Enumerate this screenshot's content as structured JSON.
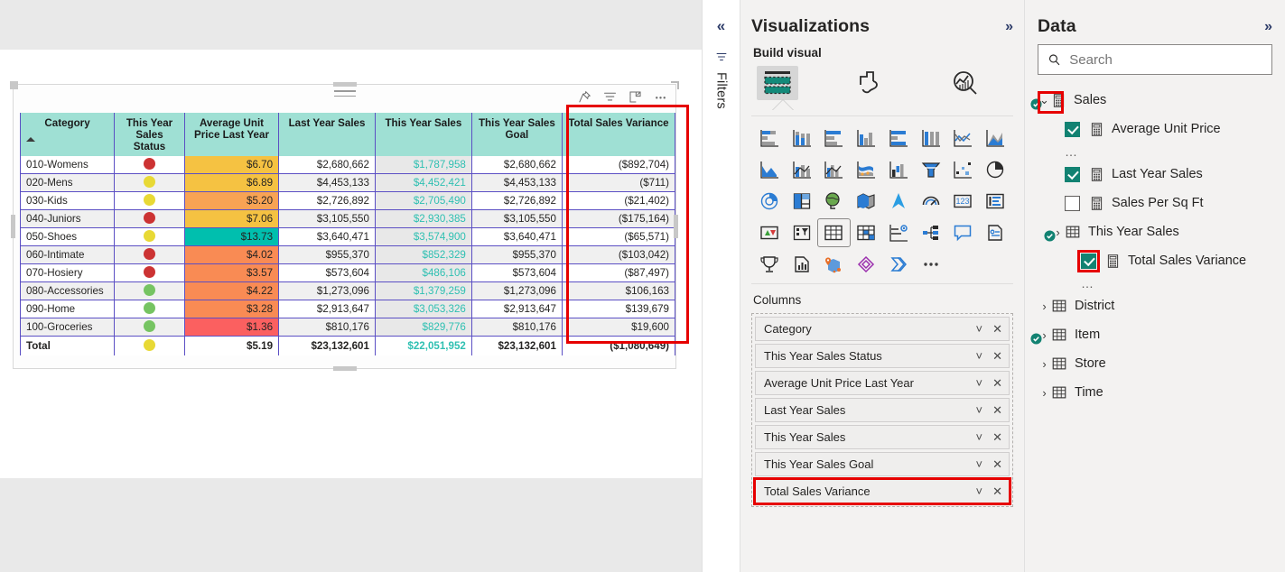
{
  "canvas": {
    "visual": {
      "toolbar_icons": [
        "pin-icon",
        "filter-icon",
        "focus-mode-icon",
        "more-options-icon"
      ],
      "sort_indicator": "ascending-sort-arrow"
    }
  },
  "table": {
    "headers": [
      "Category",
      "This Year Sales Status",
      "Average Unit Price Last Year",
      "Last Year Sales",
      "This Year Sales",
      "This Year Sales Goal",
      "Total Sales Variance"
    ],
    "rows": [
      {
        "category": "010-Womens",
        "status_color": "#cc3333",
        "aup": "$6.70",
        "aup_bg": "#f5c242",
        "lys": "$2,680,662",
        "tys": "$1,787,958",
        "goal": "$2,680,662",
        "variance": "($892,704)"
      },
      {
        "category": "020-Mens",
        "status_color": "#e8d935",
        "aup": "$6.89",
        "aup_bg": "#f5c242",
        "lys": "$4,453,133",
        "tys": "$4,452,421",
        "goal": "$4,453,133",
        "variance": "($711)"
      },
      {
        "category": "030-Kids",
        "status_color": "#e8d935",
        "aup": "$5.20",
        "aup_bg": "#f8a354",
        "lys": "$2,726,892",
        "tys": "$2,705,490",
        "goal": "$2,726,892",
        "variance": "($21,402)"
      },
      {
        "category": "040-Juniors",
        "status_color": "#cc3333",
        "aup": "$7.06",
        "aup_bg": "#f5c242",
        "lys": "$3,105,550",
        "tys": "$2,930,385",
        "goal": "$3,105,550",
        "variance": "($175,164)"
      },
      {
        "category": "050-Shoes",
        "status_color": "#e8d935",
        "aup": "$13.73",
        "aup_bg": "#00bfae",
        "lys": "$3,640,471",
        "tys": "$3,574,900",
        "goal": "$3,640,471",
        "variance": "($65,571)"
      },
      {
        "category": "060-Intimate",
        "status_color": "#cc3333",
        "aup": "$4.02",
        "aup_bg": "#f98b54",
        "lys": "$955,370",
        "tys": "$852,329",
        "goal": "$955,370",
        "variance": "($103,042)"
      },
      {
        "category": "070-Hosiery",
        "status_color": "#cc3333",
        "aup": "$3.57",
        "aup_bg": "#f98b54",
        "lys": "$573,604",
        "tys": "$486,106",
        "goal": "$573,604",
        "variance": "($87,497)"
      },
      {
        "category": "080-Accessories",
        "status_color": "#76c462",
        "aup": "$4.22",
        "aup_bg": "#f98b54",
        "lys": "$1,273,096",
        "tys": "$1,379,259",
        "goal": "$1,273,096",
        "variance": "$106,163"
      },
      {
        "category": "090-Home",
        "status_color": "#76c462",
        "aup": "$3.28",
        "aup_bg": "#f98b54",
        "lys": "$2,913,647",
        "tys": "$3,053,326",
        "goal": "$2,913,647",
        "variance": "$139,679"
      },
      {
        "category": "100-Groceries",
        "status_color": "#76c462",
        "aup": "$1.36",
        "aup_bg": "#fb6060",
        "lys": "$810,176",
        "tys": "$829,776",
        "goal": "$810,176",
        "variance": "$19,600"
      }
    ],
    "total": {
      "category": "Total",
      "status_color": "#e8d935",
      "aup": "$5.19",
      "lys": "$23,132,601",
      "tys": "$22,051,952",
      "goal": "$23,132,601",
      "variance": "($1,080,649)"
    }
  },
  "filters_rail": {
    "label": "Filters",
    "collapse_icon": "double-chevron-left-icon",
    "filter_icon": "filter-icon"
  },
  "visualizations": {
    "title": "Visualizations",
    "expand_icon": "double-chevron-right-icon",
    "build_visual_label": "Build visual",
    "build_tabs": [
      {
        "name": "build-visual-tab",
        "icon": "table-fields-icon",
        "active": true
      },
      {
        "name": "format-visual-tab",
        "icon": "paint-brush-icon",
        "active": false
      },
      {
        "name": "analytics-tab",
        "icon": "magnifier-chart-icon",
        "active": false
      }
    ],
    "viz_types": [
      "stacked-bar-chart",
      "stacked-column-chart",
      "clustered-bar-chart",
      "clustered-column-chart",
      "100-stacked-bar-chart",
      "100-stacked-column-chart",
      "line-chart",
      "area-chart",
      "stacked-area-chart",
      "line-and-stacked-column-chart",
      "line-and-clustered-column-chart",
      "ribbon-chart",
      "waterfall-chart",
      "funnel-chart",
      "scatter-chart",
      "pie-chart",
      "donut-chart",
      "treemap",
      "map",
      "filled-map",
      "azure-map",
      "gauge-chart",
      "card",
      "multi-row-card",
      "kpi",
      "slicer",
      "table",
      "matrix",
      "r-script-visual",
      "decomposition-tree",
      "q-and-a",
      "paginated-report",
      "key-influencers",
      "narrative",
      "arcgis-map",
      "powerapps",
      "power-automate",
      "more-visuals"
    ],
    "selected_viz": "table",
    "columns_label": "Columns",
    "columns": [
      {
        "label": "Category",
        "highlighted": false
      },
      {
        "label": "This Year Sales Status",
        "highlighted": false
      },
      {
        "label": "Average Unit Price Last Year",
        "highlighted": false
      },
      {
        "label": "Last Year Sales",
        "highlighted": false
      },
      {
        "label": "This Year Sales",
        "highlighted": false
      },
      {
        "label": "This Year Sales Goal",
        "highlighted": false
      },
      {
        "label": "Total Sales Variance",
        "highlighted": true
      }
    ],
    "chip_chevron": "chevron-down-icon",
    "chip_remove": "remove-field-icon"
  },
  "data_pane": {
    "title": "Data",
    "expand_icon": "double-chevron-right-icon",
    "search": {
      "placeholder": "Search",
      "value": "",
      "icon": "search-icon"
    },
    "tree": [
      {
        "name": "Sales",
        "type": "table",
        "twisty": "v",
        "twisty_highlighted": true,
        "level": 0,
        "badge": true,
        "icon": "measure-table-icon"
      },
      {
        "name": "Average Unit Price",
        "type": "measure",
        "checked": true,
        "level": 1,
        "icon": "measure-icon"
      },
      {
        "name": "ellipsis",
        "type": "ellipsis",
        "level": 1
      },
      {
        "name": "Last Year Sales",
        "type": "measure",
        "checked": true,
        "level": 1,
        "icon": "measure-icon"
      },
      {
        "name": "Sales Per Sq Ft",
        "type": "measure",
        "checked": false,
        "level": 1,
        "icon": "measure-icon"
      },
      {
        "name": "This Year Sales",
        "type": "folder",
        "twisty": ">",
        "level": 1,
        "badge": true,
        "icon": "table-icon"
      },
      {
        "name": "Total Sales Variance",
        "type": "measure",
        "checked": true,
        "checkbox_highlighted": true,
        "level": 2,
        "icon": "measure-icon"
      },
      {
        "name": "ellipsis",
        "type": "ellipsis",
        "level": 2
      },
      {
        "name": "District",
        "type": "table",
        "twisty": ">",
        "level": 0,
        "icon": "table-icon"
      },
      {
        "name": "Item",
        "type": "table",
        "twisty": ">",
        "level": 0,
        "badge": true,
        "icon": "table-icon"
      },
      {
        "name": "Store",
        "type": "table",
        "twisty": ">",
        "level": 0,
        "icon": "table-icon"
      },
      {
        "name": "Time",
        "type": "table",
        "twisty": ">",
        "level": 0,
        "icon": "table-icon"
      }
    ]
  },
  "colors": {
    "header_teal": "#9fe0d4",
    "grid_purple": "#5b4fc4",
    "accent_teal": "#2fc0b2",
    "highlight_red": "#e60000",
    "check_green": "#128272"
  }
}
